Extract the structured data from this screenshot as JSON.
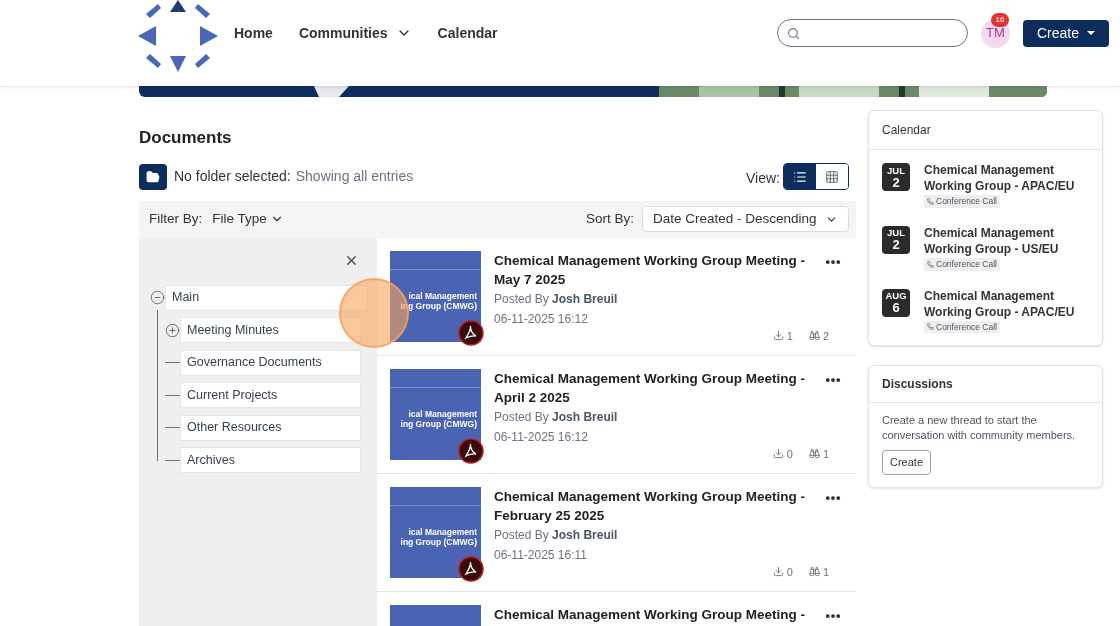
{
  "nav": {
    "items": [
      {
        "label": "Home",
        "has_menu": false
      },
      {
        "label": "Communities",
        "has_menu": true
      },
      {
        "label": "Calendar",
        "has_menu": false
      }
    ],
    "avatar": {
      "initials": "TM",
      "badge": "16"
    },
    "create_button": "Create"
  },
  "documents": {
    "title": "Documents",
    "folder_label": "No folder selected:",
    "folder_hint": "Showing all entries",
    "view_label": "View:",
    "views": [
      {
        "kind": "list",
        "selected": true
      },
      {
        "kind": "grid",
        "selected": false
      }
    ],
    "filter_label": "Filter By:",
    "filter_value": "File Type",
    "sort_label": "Sort By:",
    "sort_value": "Date Created - Descending",
    "tree": [
      {
        "label": "Main",
        "kind": "branch",
        "expanded": true,
        "children": [
          {
            "label": "Meeting Minutes",
            "kind": "branch",
            "expanded": false
          },
          {
            "label": "Governance Documents",
            "kind": "leaf"
          },
          {
            "label": "Current Projects",
            "kind": "leaf"
          },
          {
            "label": "Other Resources",
            "kind": "leaf"
          },
          {
            "label": "Archives",
            "kind": "leaf"
          }
        ]
      }
    ],
    "items": [
      {
        "title": "Chemical Management Working Group Meeting - May 7 2025",
        "posted_by": "Posted By",
        "author": "Josh Breuil",
        "date": "06-11-2025 16:12",
        "downloads": "1",
        "views": "2",
        "thumb_lines": [
          "ical Management",
          "ing Group (CMWG)"
        ]
      },
      {
        "title": "Chemical Management Working Group Meeting - April 2 2025",
        "posted_by": "Posted By",
        "author": "Josh Breuil",
        "date": "06-11-2025 16:12",
        "downloads": "0",
        "views": "1",
        "thumb_lines": [
          "ical Management",
          "ing Group (CMWG)"
        ]
      },
      {
        "title": "Chemical Management Working Group Meeting - February 25 2025",
        "posted_by": "Posted By",
        "author": "Josh Breuil",
        "date": "06-11-2025 16:11",
        "downloads": "0",
        "views": "1",
        "thumb_lines": [
          "ical Management",
          "ing Group (CMWG)"
        ]
      },
      {
        "title": "Chemical Management Working Group Meeting -",
        "partial": true
      }
    ]
  },
  "calendar": {
    "title": "Calendar",
    "events": [
      {
        "month": "JUL",
        "day": "2",
        "title": "Chemical Management Working Group - APAC/EU",
        "tag": "Conference Call"
      },
      {
        "month": "JUL",
        "day": "2",
        "title": "Chemical Management Working Group - US/EU",
        "tag": "Conference Call"
      },
      {
        "month": "AUG",
        "day": "6",
        "title": "Chemical Management Working Group - APAC/EU",
        "tag": "Conference Call"
      }
    ]
  },
  "discussions": {
    "title": "Discussions",
    "text": "Create a new thread to start the conversation with community members.",
    "button": "Create"
  }
}
